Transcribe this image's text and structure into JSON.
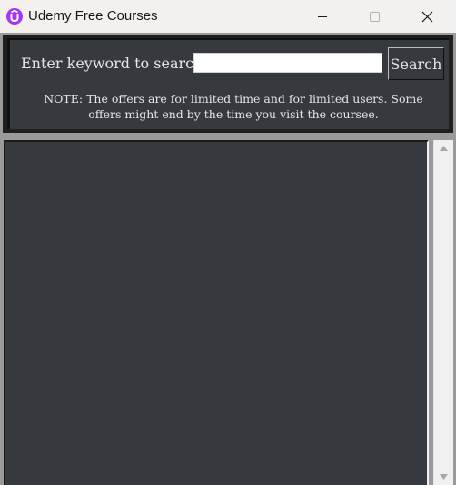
{
  "window": {
    "title": "Udemy Free Courses",
    "icon": "udemy-logo-icon",
    "accent_color": "#a435f0",
    "controls": [
      "minimize-icon",
      "maximize-icon",
      "close-icon"
    ]
  },
  "search": {
    "label": "Enter keyword to search:",
    "value": "",
    "placeholder": "",
    "button_label": "Search"
  },
  "note": {
    "text": "NOTE: The offers are for limited time and for limited users. Some offers might end by the time you visit the coursee."
  },
  "results": {
    "items": []
  },
  "colors": {
    "panel_background": "#36393e",
    "text": "#e6e6e6",
    "frame": "#9a9a9a"
  }
}
